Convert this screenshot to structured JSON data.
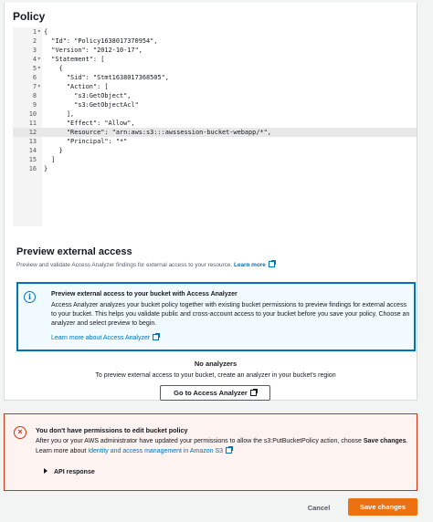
{
  "policy": {
    "title": "Policy",
    "lines": [
      {
        "n": "1",
        "fold": "▾",
        "text": "{"
      },
      {
        "n": "2",
        "fold": "",
        "text": "  \"Id\": \"Policy1638017370954\","
      },
      {
        "n": "3",
        "fold": "",
        "text": "  \"Version\": \"2012-10-17\","
      },
      {
        "n": "4",
        "fold": "▾",
        "text": "  \"Statement\": ["
      },
      {
        "n": "5",
        "fold": "▾",
        "text": "    {"
      },
      {
        "n": "6",
        "fold": "",
        "text": "      \"Sid\": \"Stmt1638017368505\","
      },
      {
        "n": "7",
        "fold": "▾",
        "text": "      \"Action\": ["
      },
      {
        "n": "8",
        "fold": "",
        "text": "        \"s3:GetObject\","
      },
      {
        "n": "9",
        "fold": "",
        "text": "        \"s3:GetObjectAcl\""
      },
      {
        "n": "10",
        "fold": "",
        "text": "      ],"
      },
      {
        "n": "11",
        "fold": "",
        "text": "      \"Effect\": \"Allow\","
      },
      {
        "n": "12",
        "fold": "",
        "text": "      \"Resource\": \"arn:aws:s3:::awssession-bucket-webapp/*\","
      },
      {
        "n": "13",
        "fold": "",
        "text": "      \"Principal\": \"*\""
      },
      {
        "n": "14",
        "fold": "",
        "text": "    }"
      },
      {
        "n": "15",
        "fold": "",
        "text": "  ]"
      },
      {
        "n": "16",
        "fold": "",
        "text": "}"
      }
    ],
    "active_line": "12"
  },
  "preview": {
    "title": "Preview external access",
    "description": "Preview and validate Access Analyzer findings for external access to your resource.",
    "learn_more": "Learn more"
  },
  "info": {
    "title": "Preview external access to your bucket with Access Analyzer",
    "body": "Access Analyzer analyzes your bucket policy together with existing bucket permissions to preview findings for external access to your bucket. This helps you validate public and cross-account access to your bucket before you save your policy. Choose an analyzer and select preview to begin.",
    "link": "Learn more about Access Analyzer"
  },
  "analyzers": {
    "title": "No analyzers",
    "description": "To preview external access to your bucket, create an analyzer in your bucket's region",
    "button": "Go to Access Analyzer"
  },
  "error": {
    "title": "You don't have permissions to edit bucket policy",
    "body_1": "After you or your AWS administrator have updated your permissions to allow the s3:PutBucketPolicy action, choose ",
    "body_bold": "Save changes",
    "body_2": ". Learn more about ",
    "body_link": "Identity and access management in Amazon S3",
    "api_response": "API response"
  },
  "footer": {
    "cancel": "Cancel",
    "save": "Save changes"
  },
  "colors": {
    "accent": "#0073bb",
    "error": "#d13212",
    "primary_button": "#ec7211"
  }
}
